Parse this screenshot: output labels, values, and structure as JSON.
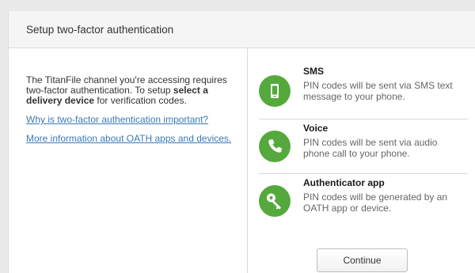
{
  "dialog": {
    "title": "Setup two-factor authentication"
  },
  "intro": {
    "text_before": "The TitanFile channel you're accessing requires two-factor authentication. To setup ",
    "text_bold": "select a delivery device",
    "text_after": " for verification codes."
  },
  "links": {
    "why_important": "Why is two-factor authentication important?",
    "oath_info": "More information about OATH apps and devices."
  },
  "options": [
    {
      "name": "SMS",
      "description": "PIN codes will be sent via SMS text message to your phone.",
      "icon": "phone-icon"
    },
    {
      "name": "Voice",
      "description": "PIN codes will be sent via audio phone call to your phone.",
      "icon": "telephone-handset-icon"
    },
    {
      "name": "Authenticator app",
      "description": "PIN codes will be generated by an OATH app or device.",
      "icon": "key-icon"
    }
  ],
  "actions": {
    "continue_label": "Continue"
  },
  "colors": {
    "accent_green": "#55a93c",
    "link_blue": "#3a7ab8"
  }
}
